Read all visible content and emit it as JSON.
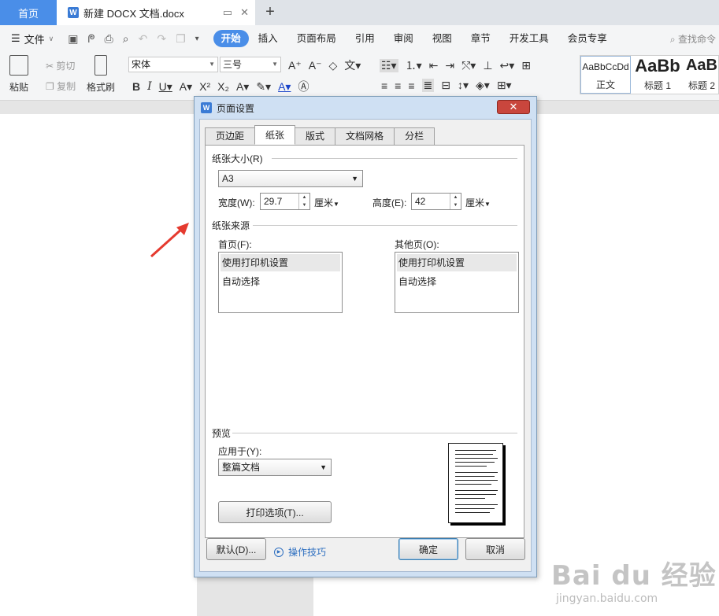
{
  "titlebar": {
    "home_tab": "首页",
    "doc_tab": "新建 DOCX 文档.docx",
    "doc_icon": "W",
    "new_tab_symbol": "+"
  },
  "menubar": {
    "file_label": "文件",
    "tabs": [
      "开始",
      "插入",
      "页面布局",
      "引用",
      "审阅",
      "视图",
      "章节",
      "开发工具",
      "会员专享"
    ],
    "active_tab": "开始",
    "search_label": "查找命令"
  },
  "ribbon": {
    "paste_label": "粘贴",
    "cut_label": "剪切",
    "copy_label": "复制",
    "format_painter_label": "格式刷",
    "font_name": "宋体",
    "font_size": "三号",
    "styles": [
      {
        "preview": "AaBbCcDd",
        "label": "正文"
      },
      {
        "preview": "AaBb",
        "label": "标题 1"
      },
      {
        "preview": "AaB",
        "label": "标题 2"
      }
    ]
  },
  "dialog": {
    "title": "页面设置",
    "icon": "W",
    "close_symbol": "✕",
    "tabs": [
      "页边距",
      "纸张",
      "版式",
      "文档网格",
      "分栏"
    ],
    "active_tab": "纸张",
    "paper_size": {
      "section_label": "纸张大小(R)",
      "selected": "A3",
      "width_label": "宽度(W):",
      "width_value": "29.7",
      "width_unit": "厘米",
      "height_label": "高度(E):",
      "height_value": "42",
      "height_unit": "厘米"
    },
    "paper_source": {
      "section_label": "纸张来源",
      "first_page_label": "首页(F):",
      "first_page_items": [
        "使用打印机设置",
        "自动选择"
      ],
      "other_pages_label": "其他页(O):",
      "other_pages_items": [
        "使用打印机设置",
        "自动选择"
      ]
    },
    "preview": {
      "section_label": "预览",
      "apply_to_label": "应用于(Y):",
      "apply_to_value": "整篇文档",
      "print_options_button": "打印选项(T)..."
    },
    "footer": {
      "default_button": "默认(D)...",
      "tips_link": "操作技巧",
      "ok_button": "确定",
      "cancel_button": "取消"
    }
  },
  "watermark": {
    "brand": "Bai du 经验",
    "url": "jingyan.baidu.com"
  },
  "colors": {
    "accent": "#4a8ee8",
    "close_button": "#c9463d",
    "annotation_arrow": "#e53a2f"
  }
}
